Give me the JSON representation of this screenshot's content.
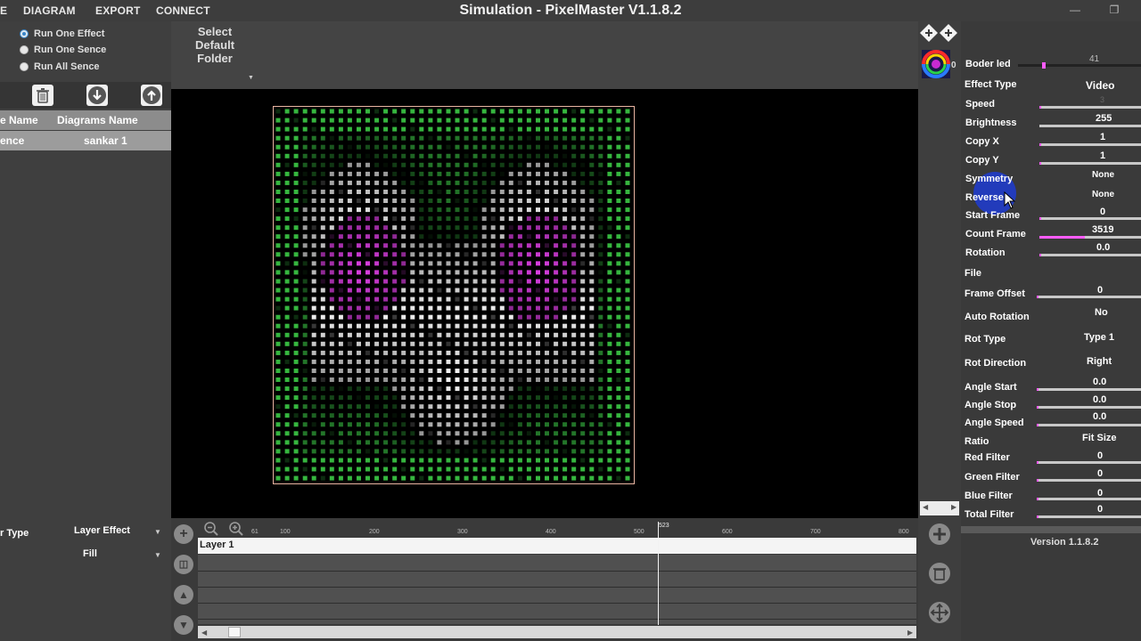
{
  "menu": {
    "items": [
      "E",
      "DIAGRAM",
      "EXPORT",
      "CONNECT"
    ]
  },
  "window": {
    "title": "Simulation - PixelMaster V1.1.8.2"
  },
  "left": {
    "radios": [
      {
        "label": "Run One Effect",
        "checked": true
      },
      {
        "label": "Run One Sence",
        "checked": false
      },
      {
        "label": "Run All Sence",
        "checked": false
      }
    ],
    "list_headers": [
      "e Name",
      "Diagrams Name"
    ],
    "list_rows": [
      {
        "name": "ence",
        "diagram": "sankar 1"
      }
    ],
    "layer_type_label": "r Type",
    "layer_type_value": "Layer Effect",
    "fill_value": "Fill"
  },
  "folder": {
    "label_lines": [
      "Select",
      "Default",
      "Folder"
    ]
  },
  "timeline": {
    "ticks": [
      "61",
      "100",
      "200",
      "300",
      "400",
      "500",
      "600",
      "700",
      "800"
    ],
    "playhead_label": "523",
    "layer_name": "Layer 1"
  },
  "right": {
    "thumb_count": "0",
    "props": {
      "boder_led": {
        "label": "Boder led",
        "value": "41"
      },
      "effect_type": {
        "label": "Effect Type",
        "value": "Video"
      },
      "speed": {
        "label": "Speed",
        "value": "3",
        "level": 0.01
      },
      "brightness": {
        "label": "Brightness",
        "value": "255",
        "level": 1.0
      },
      "copy_x": {
        "label": "Copy X",
        "value": "1",
        "level": 0.0
      },
      "copy_y": {
        "label": "Copy Y",
        "value": "1",
        "level": 0.0
      },
      "symmetry": {
        "label": "Symmetry",
        "value": "None"
      },
      "reverse": {
        "label": "Reverse",
        "value": "None"
      },
      "start_frame": {
        "label": "Start Frame",
        "value": "0",
        "level": 0.0
      },
      "count_frame": {
        "label": "Count Frame",
        "value": "3519",
        "level": 0.45
      },
      "rotation": {
        "label": "Rotation",
        "value": "0.0",
        "level": 0.0
      },
      "file": {
        "label": "File",
        "value": ""
      },
      "frame_offset": {
        "label": "Frame Offset",
        "value": "0",
        "level": 0.0
      },
      "auto_rotation": {
        "label": "Auto Rotation",
        "value": "No"
      },
      "rot_type": {
        "label": "Rot Type",
        "value": "Type 1"
      },
      "rot_direction": {
        "label": "Rot Direction",
        "value": "Right"
      },
      "angle_start": {
        "label": "Angle Start",
        "value": "0.0",
        "level": 0.0
      },
      "angle_stop": {
        "label": "Angle Stop",
        "value": "0.0",
        "level": 0.0
      },
      "angle_speed": {
        "label": "Angle Speed",
        "value": "0.0",
        "level": 0.0
      },
      "ratio": {
        "label": "Ratio",
        "value": "Fit Size"
      },
      "red_filter": {
        "label": "Red Filter",
        "value": "0",
        "level": 0.0
      },
      "green_filter": {
        "label": "Green Filter",
        "value": "0",
        "level": 0.0
      },
      "blue_filter": {
        "label": "Blue Filter",
        "value": "0",
        "level": 0.0
      },
      "total_filter": {
        "label": "Total Filter",
        "value": "0",
        "level": 0.0
      }
    },
    "version": "Version 1.1.8.2"
  },
  "colors": {
    "accent_slider": "#ff5cff",
    "led_green": "#3fd64a",
    "led_white": "#ffffff",
    "led_magenta": "#e040e8",
    "cursor_highlight": "#1e3cd2",
    "frame_border": "#e9b5a2"
  },
  "icons": {
    "left_toolbar": [
      "trash-icon",
      "download-arrow-icon",
      "upload-arrow-icon"
    ],
    "timeline_tools": [
      "add-icon",
      "trash-icon",
      "arrow-up-icon",
      "arrow-down-icon"
    ],
    "zoom": [
      "zoom-out-icon",
      "zoom-in-icon"
    ],
    "right_tools": [
      "add-icon",
      "trash-icon",
      "move-icon"
    ]
  }
}
